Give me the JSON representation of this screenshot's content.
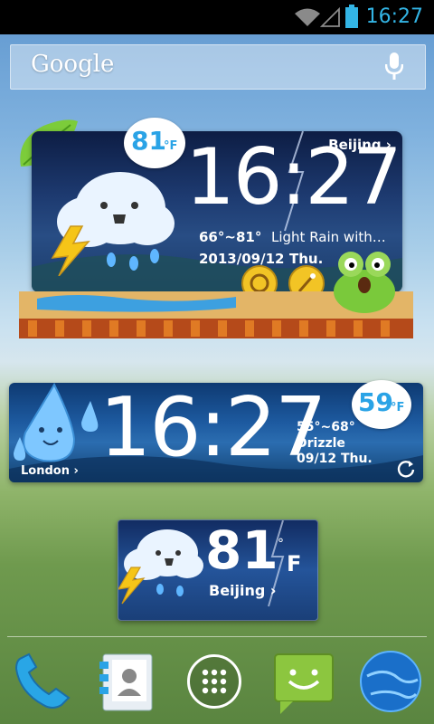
{
  "status_bar": {
    "time": "16:27",
    "accent": "#33b5e5"
  },
  "search": {
    "logo": "Google"
  },
  "widget_large": {
    "badge_temp": "81",
    "badge_unit": "°F",
    "city": "Beijing ›",
    "time": "16:27",
    "range": "66°~81°",
    "condition": "Light Rain with…",
    "date": "2013/09/12",
    "day": "Thu."
  },
  "widget_wide": {
    "badge_temp": "59",
    "badge_unit": "°F",
    "time": "16:27",
    "range": "55°~68°",
    "condition": "Drizzle",
    "date": "09/12 Thu.",
    "city": "London ›"
  },
  "widget_small": {
    "temp": "81",
    "degree": "°",
    "unit": "F",
    "city": "Beijing ›"
  },
  "dock": {
    "items": [
      "phone-icon",
      "contacts-icon",
      "app-drawer-icon",
      "messaging-icon",
      "browser-icon"
    ]
  }
}
